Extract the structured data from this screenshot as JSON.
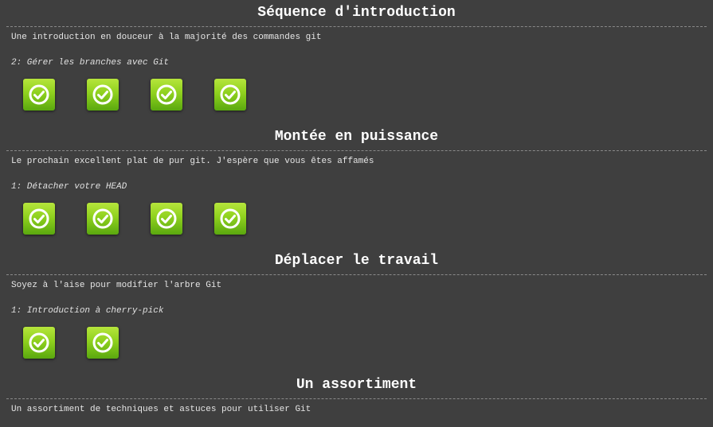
{
  "sections": [
    {
      "title": "Séquence d'introduction",
      "description": "Une introduction en douceur à la majorité des commandes git",
      "current_level": "2: Gérer les branches avec Git",
      "levels": [
        {
          "status": "completed",
          "icon": "check-circle-icon"
        },
        {
          "status": "completed",
          "icon": "check-circle-icon"
        },
        {
          "status": "completed",
          "icon": "check-circle-icon"
        },
        {
          "status": "completed",
          "icon": "check-circle-icon"
        }
      ]
    },
    {
      "title": "Montée en puissance",
      "description": "Le prochain excellent plat de pur git. J'espère que vous êtes affamés",
      "current_level": "1: Détacher votre HEAD",
      "levels": [
        {
          "status": "completed",
          "icon": "check-circle-icon"
        },
        {
          "status": "completed",
          "icon": "check-circle-icon"
        },
        {
          "status": "completed",
          "icon": "check-circle-icon"
        },
        {
          "status": "completed",
          "icon": "check-circle-icon"
        }
      ]
    },
    {
      "title": "Déplacer le travail",
      "description": "Soyez à l'aise pour modifier l'arbre Git",
      "current_level": "1: Introduction à cherry-pick",
      "levels": [
        {
          "status": "completed",
          "icon": "check-circle-icon"
        },
        {
          "status": "completed",
          "icon": "check-circle-icon"
        }
      ]
    },
    {
      "title": "Un assortiment",
      "description": "Un assortiment de techniques et astuces pour utiliser Git",
      "current_level": "",
      "levels": []
    }
  ],
  "colors": {
    "background": "#3f3f3f",
    "level_complete": "#8fd11e",
    "divider": "#8a8a8a"
  }
}
